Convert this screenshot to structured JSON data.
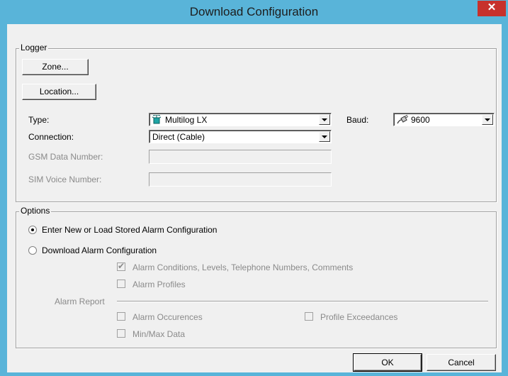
{
  "window": {
    "title": "Download Configuration",
    "close_glyph": "✕"
  },
  "logger": {
    "group_label": "Logger",
    "zone_button": "Zone...",
    "location_button": "Location...",
    "type_label": "Type:",
    "type_value": "Multilog LX",
    "type_icon": "logger-antenna-icon",
    "baud_label": "Baud:",
    "baud_value": "9600",
    "baud_icon": "cable-plug-icon",
    "connection_label": "Connection:",
    "connection_value": "Direct (Cable)",
    "gsm_label": "GSM Data Number:",
    "gsm_value": "",
    "sim_label": "SIM Voice Number:",
    "sim_value": ""
  },
  "options": {
    "group_label": "Options",
    "radio_enter_label": "Enter New or Load Stored Alarm Configuration",
    "radio_enter_selected": true,
    "radio_download_label": "Download Alarm Configuration",
    "radio_download_selected": false,
    "alarm_conditions_label": "Alarm Conditions, Levels, Telephone Numbers, Comments",
    "alarm_conditions_checked": true,
    "alarm_profiles_label": "Alarm Profiles",
    "alarm_profiles_checked": false,
    "alarm_report_label": "Alarm Report",
    "alarm_occurences_label": "Alarm Occurences",
    "alarm_occurences_checked": false,
    "profile_exceedances_label": "Profile Exceedances",
    "profile_exceedances_checked": false,
    "minmax_label": "Min/Max Data",
    "minmax_checked": false
  },
  "buttons": {
    "ok": "OK",
    "cancel": "Cancel"
  },
  "colors": {
    "titlebar": "#59b4d9",
    "close": "#c7312c",
    "dialog_bg": "#f0f0f0",
    "disabled_text": "#8a8a8a"
  }
}
